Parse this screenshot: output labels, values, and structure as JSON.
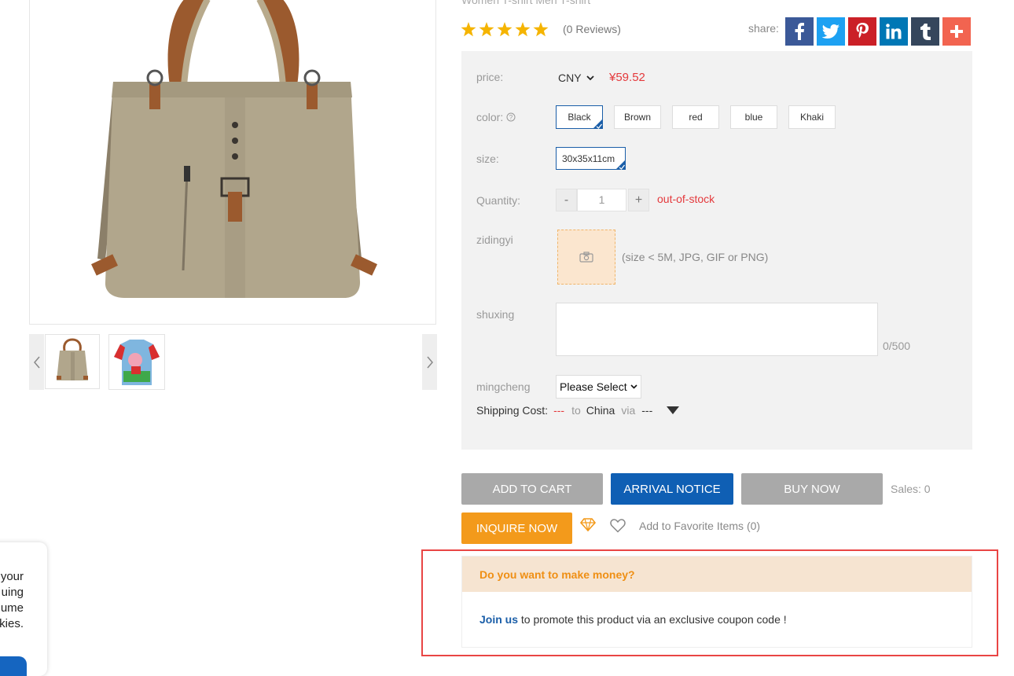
{
  "product": {
    "title": "Women T-shirt Men T-shirt",
    "rating_stars": 5,
    "reviews": "(0 Reviews)"
  },
  "share": {
    "label": "share:",
    "buttons": [
      {
        "name": "facebook",
        "glyph": "f",
        "color": "#3b5998"
      },
      {
        "name": "twitter",
        "glyph": "t",
        "color": "#1da1f2"
      },
      {
        "name": "pinterest",
        "glyph": "p",
        "color": "#cb2027"
      },
      {
        "name": "linkedin",
        "glyph": "in",
        "color": "#0077b5"
      },
      {
        "name": "tumblr",
        "glyph": "t",
        "color": "#35465c"
      },
      {
        "name": "more",
        "glyph": "+",
        "color": "#f26450"
      }
    ]
  },
  "options": {
    "price_label": "price:",
    "currency": "CNY",
    "price": "¥59.52",
    "color_label": "color:",
    "colors": [
      "Black",
      "Brown",
      "red",
      "blue",
      "Khaki"
    ],
    "selected_color": "Black",
    "size_label": "size:",
    "sizes": [
      "30x35x11cm"
    ],
    "quantity_label": "Quantity:",
    "quantity_minus": "-",
    "quantity": "1",
    "quantity_plus": "+",
    "stock_status": "out-of-stock",
    "custom_label": "zidingyi",
    "upload_hint": "(size < 5M, JPG, GIF or PNG)",
    "attribute_label": "shuxing",
    "char_count": "0/500",
    "name_label": "mingcheng",
    "name_select": "Please Select",
    "shipping_label": "Shipping Cost:",
    "shipping_cost": "---",
    "shipping_to": "to",
    "shipping_country": "China",
    "shipping_via": "via",
    "shipping_method": "---"
  },
  "actions": {
    "add_to_cart": "ADD TO CART",
    "arrival_notice": "ARRIVAL NOTICE",
    "buy_now": "BUY NOW",
    "sales": "Sales: 0",
    "inquire_now": "INQUIRE NOW",
    "favorite": "Add to Favorite Items (0)"
  },
  "promo": {
    "heading": "Do you want to make money?",
    "link": "Join us",
    "text": "to promote this product via an exclusive coupon code !"
  },
  "cookie": {
    "lines": [
      "your",
      "uing",
      "ume",
      "kies."
    ]
  },
  "colors": {
    "accent_red": "#e4393c",
    "brand_blue": "#0f5fb4",
    "gray_button": "#a9a9a9",
    "orange_button": "#f39a1b"
  }
}
